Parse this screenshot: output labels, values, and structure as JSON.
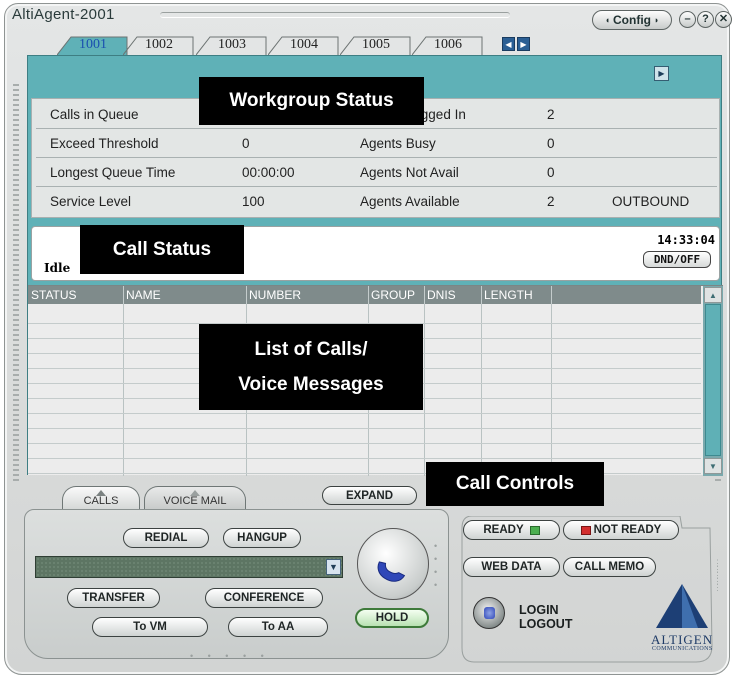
{
  "window": {
    "title": "AltiAgent-2001"
  },
  "titlebar": {
    "config_label": "Config",
    "minimize_icon": "minimize-icon",
    "help_label": "?",
    "close_label": "✕"
  },
  "tabs": [
    "1001",
    "1002",
    "1003",
    "1004",
    "1005",
    "1006"
  ],
  "active_tab": "1001",
  "workgroup": {
    "rows": [
      {
        "left_label": "Calls in Queue",
        "left_value": "",
        "right_label": "Agents Logged In",
        "right_value": "2",
        "extra": ""
      },
      {
        "left_label": "Exceed Threshold",
        "left_value": "0",
        "right_label": "Agents Busy",
        "right_value": "0",
        "extra": ""
      },
      {
        "left_label": "Longest Queue Time",
        "left_value": "00:00:00",
        "right_label": "Agents Not Avail",
        "right_value": "0",
        "extra": ""
      },
      {
        "left_label": "Service Level",
        "left_value": "100",
        "right_label": "Agents Available",
        "right_value": "2",
        "extra": "OUTBOUND"
      }
    ]
  },
  "call_status": {
    "state": "Idle",
    "time": "14:33:04",
    "dnd_label": "DND/OFF"
  },
  "calls_table": {
    "columns": [
      "STATUS",
      "NAME",
      "NUMBER",
      "GROUP",
      "DNIS",
      "LENGTH"
    ]
  },
  "overlays": {
    "workgroup_status": "Workgroup Status",
    "call_status": "Call Status",
    "list_line1": "List of Calls/",
    "list_line2": "Voice Messages",
    "call_controls": "Call Controls"
  },
  "bottom_tabs": {
    "calls": "CALLS",
    "voicemail": "VOICE MAIL"
  },
  "controls": {
    "expand": "EXPAND",
    "redial": "REDIAL",
    "hangup": "HANGUP",
    "transfer": "TRANSFER",
    "conference": "CONFERENCE",
    "to_vm": "To VM",
    "to_aa": "To AA",
    "hold": "HOLD",
    "ready": "READY",
    "not_ready": "NOT READY",
    "web_data": "WEB DATA",
    "call_memo": "CALL MEMO",
    "login": "LOGIN",
    "logout": "LOGOUT"
  },
  "logo": {
    "name": "ALTIGEN",
    "sub": "COMMUNICATIONS"
  },
  "colors": {
    "panel": "#5fb1b7",
    "ready_led": "#4caf50",
    "not_ready_led": "#d32f2f",
    "phone_blue": "#2f47b8"
  }
}
